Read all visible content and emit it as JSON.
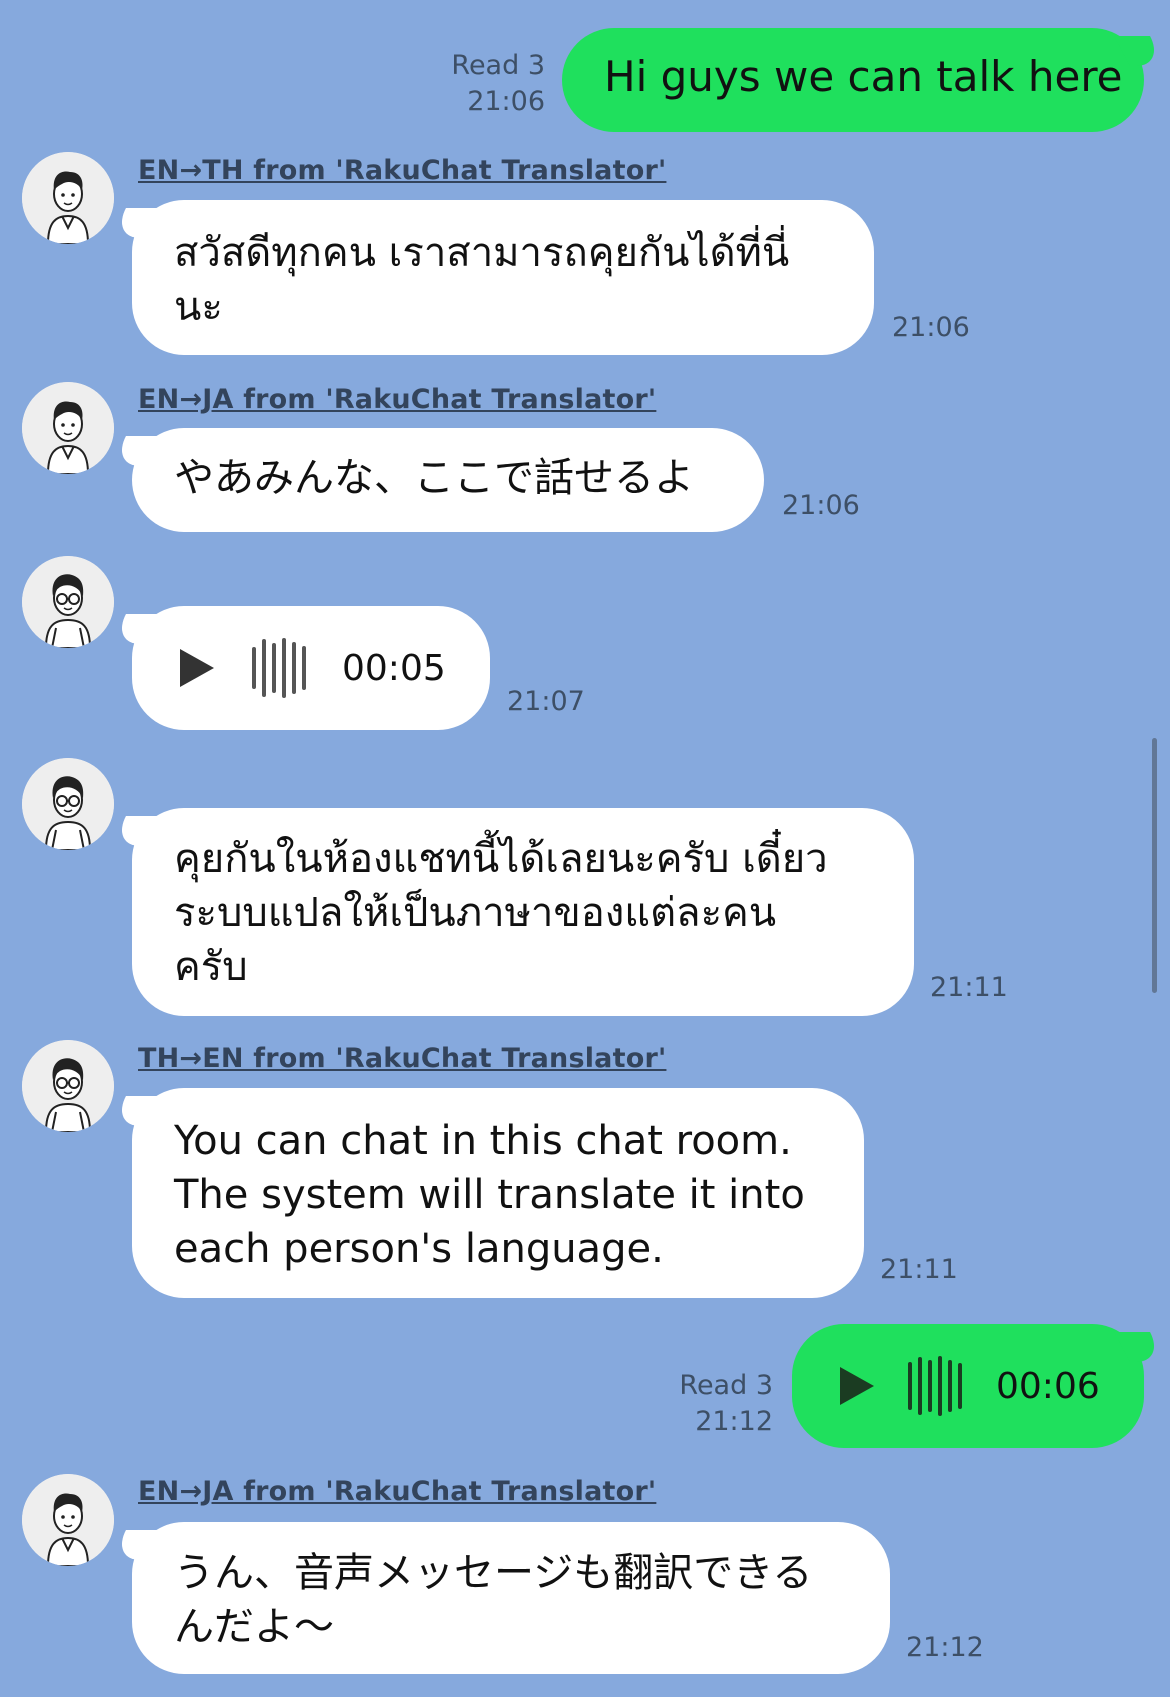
{
  "colors": {
    "background": "#86a9dd",
    "outgoing_bubble": "#1fe05d",
    "incoming_bubble": "#ffffff"
  },
  "messages": [
    {
      "kind": "out-text",
      "read": "Read 3",
      "time": "21:06",
      "text": "Hi guys we can talk here"
    },
    {
      "kind": "in-text",
      "avatar": "man-avatar-icon",
      "sender": "EN→TH from 'RakuChat Translator'",
      "text": "สวัสดีทุกคน เราสามารถคุยกันได้ที่นี่\nนะ",
      "time": "21:06"
    },
    {
      "kind": "in-text",
      "avatar": "man-avatar-icon",
      "sender": "EN→JA from 'RakuChat Translator'",
      "text": "やあみんな、ここで話せるよ",
      "time": "21:06"
    },
    {
      "kind": "in-voice",
      "avatar": "man-glasses-avatar-icon",
      "duration": "00:05",
      "time": "21:07"
    },
    {
      "kind": "in-text",
      "avatar": "man-glasses-avatar-icon",
      "text": "คุยกันในห้องแชทนี้ได้เลยนะครับ เดี๋ยว\nระบบแปลให้เป็นภาษาของแต่ละคน\nครับ",
      "time": "21:11"
    },
    {
      "kind": "in-text",
      "avatar": "man-glasses-avatar-icon",
      "sender": "TH→EN from 'RakuChat Translator'",
      "text": "You can chat in this chat room.\nThe system will translate it into\neach person's language.",
      "time": "21:11"
    },
    {
      "kind": "out-voice",
      "read": "Read 3",
      "time": "21:12",
      "duration": "00:06"
    },
    {
      "kind": "in-text",
      "avatar": "man-avatar-icon",
      "sender": "EN→JA from 'RakuChat Translator'",
      "text": "うん、音声メッセージも翻訳できる\nんだよ〜",
      "time": "21:12"
    }
  ]
}
